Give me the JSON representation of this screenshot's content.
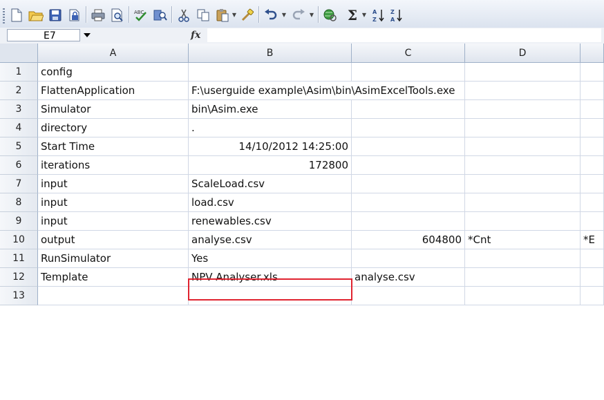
{
  "toolbar": {
    "icons": [
      "new-document-icon",
      "open-folder-icon",
      "save-disk-icon",
      "permission-icon",
      "print-icon",
      "print-preview-icon",
      "spelling-check-icon",
      "research-icon",
      "cut-scissors-icon",
      "copy-icon",
      "paste-icon",
      "format-painter-icon",
      "undo-icon",
      "redo-icon",
      "hyperlink-icon",
      "autosum-sigma-icon",
      "sort-ascending-icon",
      "sort-descending-icon"
    ],
    "sigma": "Σ",
    "sort_asc": "A↓Z",
    "sort_desc": "Z↓A"
  },
  "formula_bar": {
    "name_box": "E7",
    "fx_label": "fx",
    "formula": ""
  },
  "columns": [
    "A",
    "B",
    "C",
    "D"
  ],
  "rows": [
    {
      "num": "1",
      "A": "config",
      "B": "",
      "C": "",
      "D": "",
      "E": ""
    },
    {
      "num": "2",
      "A": "FlattenApplication",
      "B": "F:\\userguide example\\Asim\\bin\\AsimExcelTools.exe",
      "C": "",
      "D": "",
      "E": ""
    },
    {
      "num": "3",
      "A": "Simulator",
      "B": "bin\\Asim.exe",
      "C": "",
      "D": "",
      "E": ""
    },
    {
      "num": "4",
      "A": "directory",
      "B": ".",
      "C": "",
      "D": "",
      "E": ""
    },
    {
      "num": "5",
      "A": "Start Time",
      "B": "14/10/2012 14:25:00",
      "C": "",
      "D": "",
      "E": ""
    },
    {
      "num": "6",
      "A": "iterations",
      "B": "172800",
      "C": "",
      "D": "",
      "E": ""
    },
    {
      "num": "7",
      "A": "input",
      "B": "ScaleLoad.csv",
      "C": "",
      "D": "",
      "E": ""
    },
    {
      "num": "8",
      "A": "input",
      "B": "load.csv",
      "C": "",
      "D": "",
      "E": ""
    },
    {
      "num": "9",
      "A": "input",
      "B": "renewables.csv",
      "C": "",
      "D": "",
      "E": ""
    },
    {
      "num": "10",
      "A": "output",
      "B": "analyse.csv",
      "C": "604800",
      "D": "*Cnt",
      "E": "*E"
    },
    {
      "num": "11",
      "A": "RunSimulator",
      "B": "Yes",
      "C": "",
      "D": "",
      "E": ""
    },
    {
      "num": "12",
      "A": "Template",
      "B": "NPV Analyser.xls",
      "C": "analyse.csv",
      "D": "",
      "E": ""
    },
    {
      "num": "13",
      "A": "",
      "B": "",
      "C": "",
      "D": "",
      "E": ""
    }
  ],
  "highlight": {
    "cell": "B7",
    "color": "#e0232f"
  }
}
